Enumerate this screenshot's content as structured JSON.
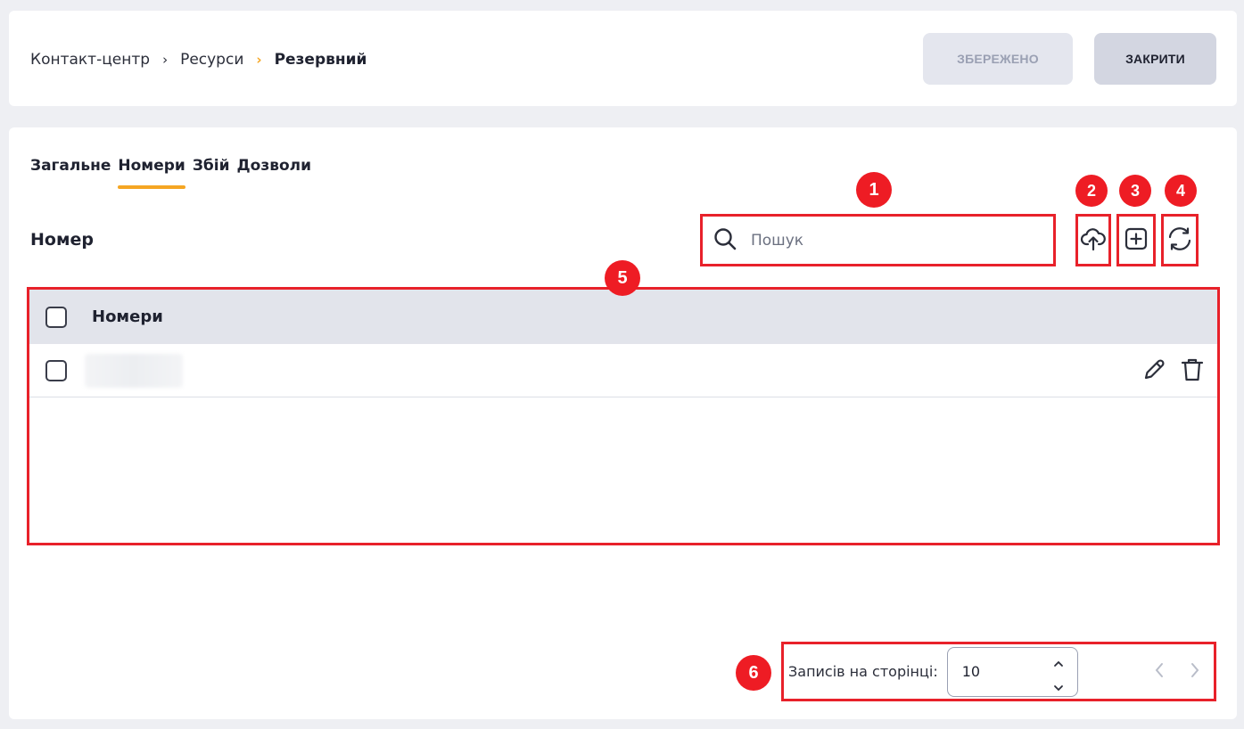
{
  "breadcrumb": {
    "items": [
      "Контакт-центр",
      "Ресурси"
    ],
    "current": "Резервний"
  },
  "header": {
    "saved_label": "ЗБЕРЕЖЕНО",
    "close_label": "ЗАКРИТИ"
  },
  "tabs": [
    {
      "label": "Загальне",
      "active": false
    },
    {
      "label": "Номери",
      "active": true
    },
    {
      "label": "Збій",
      "active": false
    },
    {
      "label": "Дозволи",
      "active": false
    }
  ],
  "section": {
    "title": "Номер"
  },
  "search": {
    "placeholder": "Пошук"
  },
  "table": {
    "column_header": "Номери",
    "rows": [
      {
        "value": "blurred"
      }
    ]
  },
  "pagination": {
    "label": "Записів на сторінці:",
    "per_page": "10"
  },
  "badges": [
    "1",
    "2",
    "3",
    "4",
    "5",
    "6"
  ],
  "colors": {
    "accent": "#f5a623",
    "annotation_red": "#e8212a"
  },
  "icons": {
    "search": "search-icon",
    "upload": "upload-cloud-icon",
    "add": "plus-square-icon",
    "refresh": "refresh-icon",
    "edit": "pencil-icon",
    "delete": "trash-icon"
  }
}
